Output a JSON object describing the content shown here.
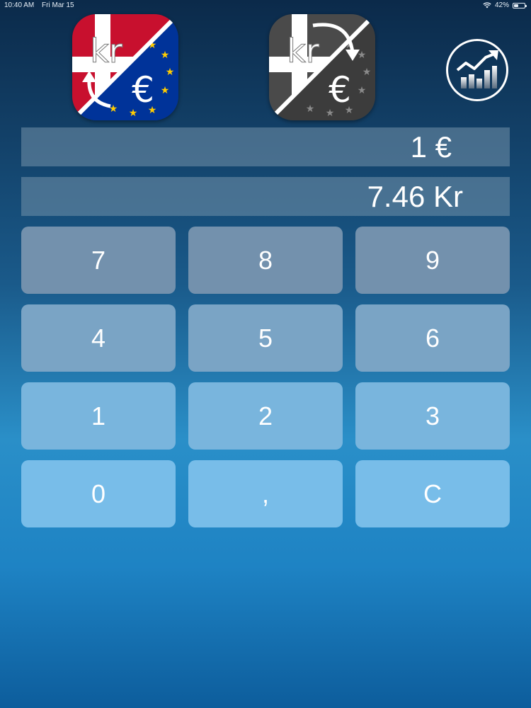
{
  "status_bar": {
    "time": "10:40 AM",
    "date": "Fri Mar 15",
    "battery": "42%",
    "battery_level": 0.42
  },
  "icons": {
    "left_app_icon": "dkk-eur-flag-icon",
    "right_app_icon": "dkk-eur-gray-icon",
    "chart_icon": "chart-trend-icon",
    "icon_text_kr": "kr",
    "icon_text_euro": "€"
  },
  "display": {
    "eur_value": "1 €",
    "dkk_value": "7.46 Kr"
  },
  "keypad": {
    "keys": [
      "7",
      "8",
      "9",
      "4",
      "5",
      "6",
      "1",
      "2",
      "3",
      "0",
      ",",
      "C"
    ]
  },
  "colors": {
    "denmark_red": "#c8102e",
    "eu_blue": "#003399",
    "eu_star_yellow": "#ffcc00",
    "gray_icon": "#4a4a4a"
  }
}
